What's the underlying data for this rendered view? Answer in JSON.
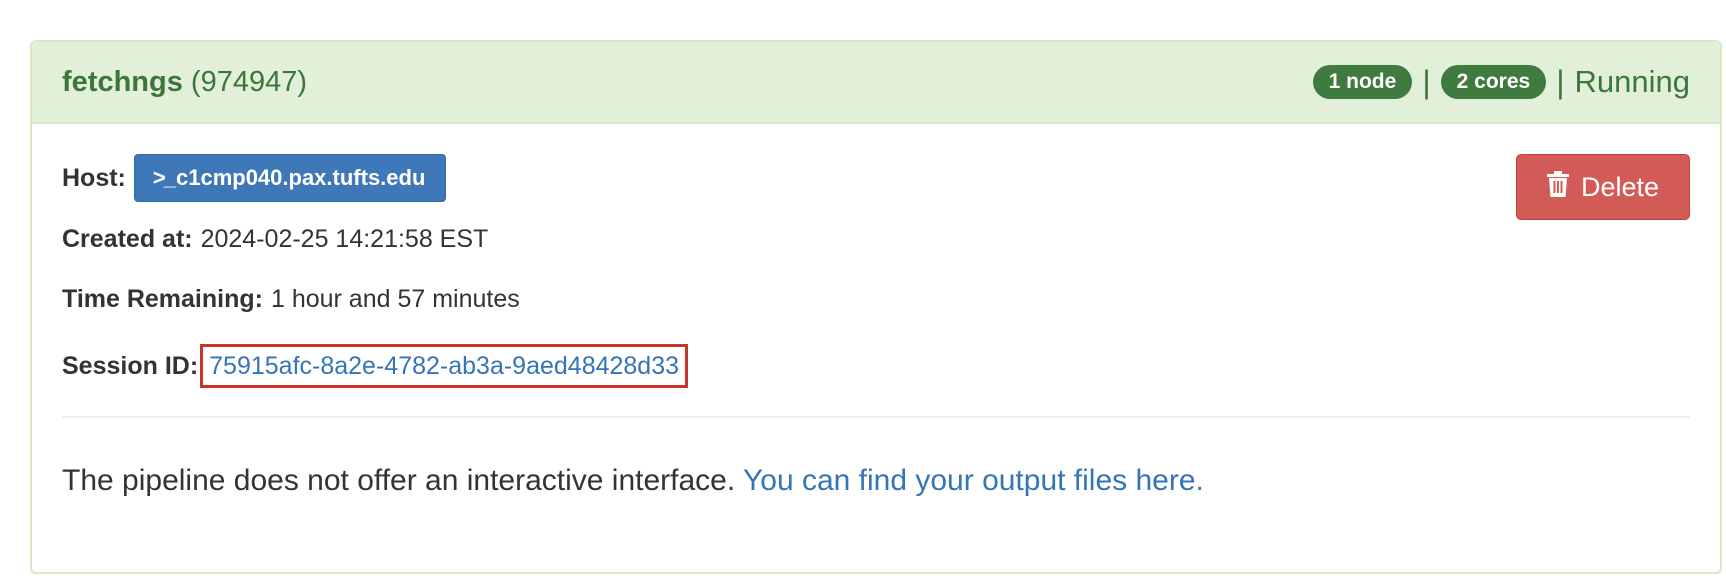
{
  "panel": {
    "title": "fetchngs",
    "job_id": "(974947)",
    "nodes_badge": "1 node",
    "separator": "|",
    "cores_badge": "2 cores",
    "status": "Running"
  },
  "details": {
    "host_label": "Host:",
    "host_icon": "terminal-icon",
    "host_value": "c1cmp040.pax.tufts.edu",
    "created_label": "Created at:",
    "created_value": "2024-02-25 14:21:58 EST",
    "remaining_label": "Time Remaining:",
    "remaining_value": "1 hour and 57 minutes",
    "session_label": "Session ID:",
    "session_value": "75915afc-8a2e-4782-ab3a-9aed48428d33"
  },
  "actions": {
    "delete_icon": "trash-icon",
    "delete_label": "Delete"
  },
  "message": {
    "text": "The pipeline does not offer an interactive interface. ",
    "link_text": "You can find your output files here."
  },
  "colors": {
    "panel_heading_bg": "#e2f0d9",
    "panel_heading_text": "#3c763d",
    "badge_bg": "#3f7a3f",
    "host_button_bg": "#3f78b8",
    "delete_button_bg": "#d25b57",
    "link": "#3575b5",
    "highlight_border": "#c9352a"
  }
}
